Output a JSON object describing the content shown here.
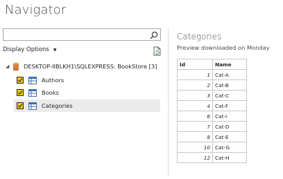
{
  "window": {
    "title": "Navigator"
  },
  "search": {
    "value": "",
    "placeholder": "",
    "icon": "search-icon"
  },
  "toolbar": {
    "display_options_label": "Display Options",
    "refresh_icon": "refresh-icon"
  },
  "tree": {
    "root": {
      "label": "DESKTOP-IIBLKH1\\SQLEXPRESS: BookStore [3]",
      "icon": "database-icon"
    },
    "items": [
      {
        "label": "Authors",
        "checked": true,
        "selected": false
      },
      {
        "label": "Books",
        "checked": true,
        "selected": false
      },
      {
        "label": "Categories",
        "checked": true,
        "selected": true
      }
    ]
  },
  "preview": {
    "title": "Categories",
    "subtitle": "Preview downloaded on Monday",
    "columns": [
      "Id",
      "Name"
    ],
    "rows": [
      [
        "1",
        "Cat-A"
      ],
      [
        "2",
        "Cat-B"
      ],
      [
        "3",
        "Cat-C"
      ],
      [
        "4",
        "Cat-F"
      ],
      [
        "6",
        "Cat-I"
      ],
      [
        "7",
        "Cat-D"
      ],
      [
        "8",
        "Cat-E"
      ],
      [
        "10",
        "Cat-G"
      ],
      [
        "12",
        "Cat-H"
      ]
    ]
  },
  "colors": {
    "checkbox": "#f2c811",
    "database": "#d8803c",
    "table_icon": "#3b6fb0"
  }
}
